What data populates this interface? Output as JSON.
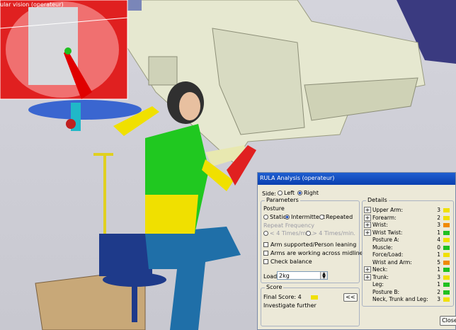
{
  "inset": {
    "title": "ular vision (operateur)"
  },
  "dialog": {
    "title": "RULA Analysis (operateur)",
    "side": {
      "label": "Side:",
      "options": [
        "Left",
        "Right"
      ],
      "selected": "Right"
    },
    "parameters": {
      "title": "Parameters",
      "posture_label": "Posture",
      "posture_options": [
        "Static",
        "Intermittent",
        "Repeated"
      ],
      "posture_selected": "Intermittent",
      "repeat_label": "Repeat Frequency",
      "repeat_options": [
        "< 4 Times/min.",
        "> 4 Times/min."
      ],
      "checkboxes": [
        "Arm supported/Person leaning",
        "Arms are working across midline",
        "Check balance"
      ],
      "load_label": "Load:",
      "load_value": "2kg"
    },
    "score": {
      "title": "Score",
      "final_score_label": "Final Score: 4",
      "final_score_color": "#f0e000",
      "recommendation": "Investigate further",
      "collapse_label": "<<"
    },
    "details": {
      "title": "Details",
      "rows": [
        {
          "label": "Upper Arm:",
          "value": "3",
          "color": "#f0e000",
          "expand": true
        },
        {
          "label": "Forearm:",
          "value": "2",
          "color": "#f0e000",
          "expand": true
        },
        {
          "label": "Wrist:",
          "value": "3",
          "color": "#f08a00",
          "expand": true
        },
        {
          "label": "Wrist Twist:",
          "value": "1",
          "color": "#20c020",
          "expand": true
        },
        {
          "label": "Posture A:",
          "value": "4",
          "color": "#f0e000",
          "expand": false
        },
        {
          "label": "Muscle:",
          "value": "0",
          "color": "#20c020",
          "expand": false
        },
        {
          "label": "Force/Load:",
          "value": "1",
          "color": "#f0e000",
          "expand": false
        },
        {
          "label": "Wrist and Arm:",
          "value": "5",
          "color": "#f08a00",
          "expand": false
        },
        {
          "label": "Neck:",
          "value": "1",
          "color": "#20c020",
          "expand": true
        },
        {
          "label": "Trunk:",
          "value": "3",
          "color": "#f0e000",
          "expand": true
        },
        {
          "label": "Leg:",
          "value": "1",
          "color": "#20c020",
          "expand": false
        },
        {
          "label": "Posture B:",
          "value": "2",
          "color": "#20c020",
          "expand": false
        },
        {
          "label": "Neck, Trunk and Leg:",
          "value": "3",
          "color": "#f0e000",
          "expand": false
        }
      ]
    },
    "close_label": "Close"
  }
}
